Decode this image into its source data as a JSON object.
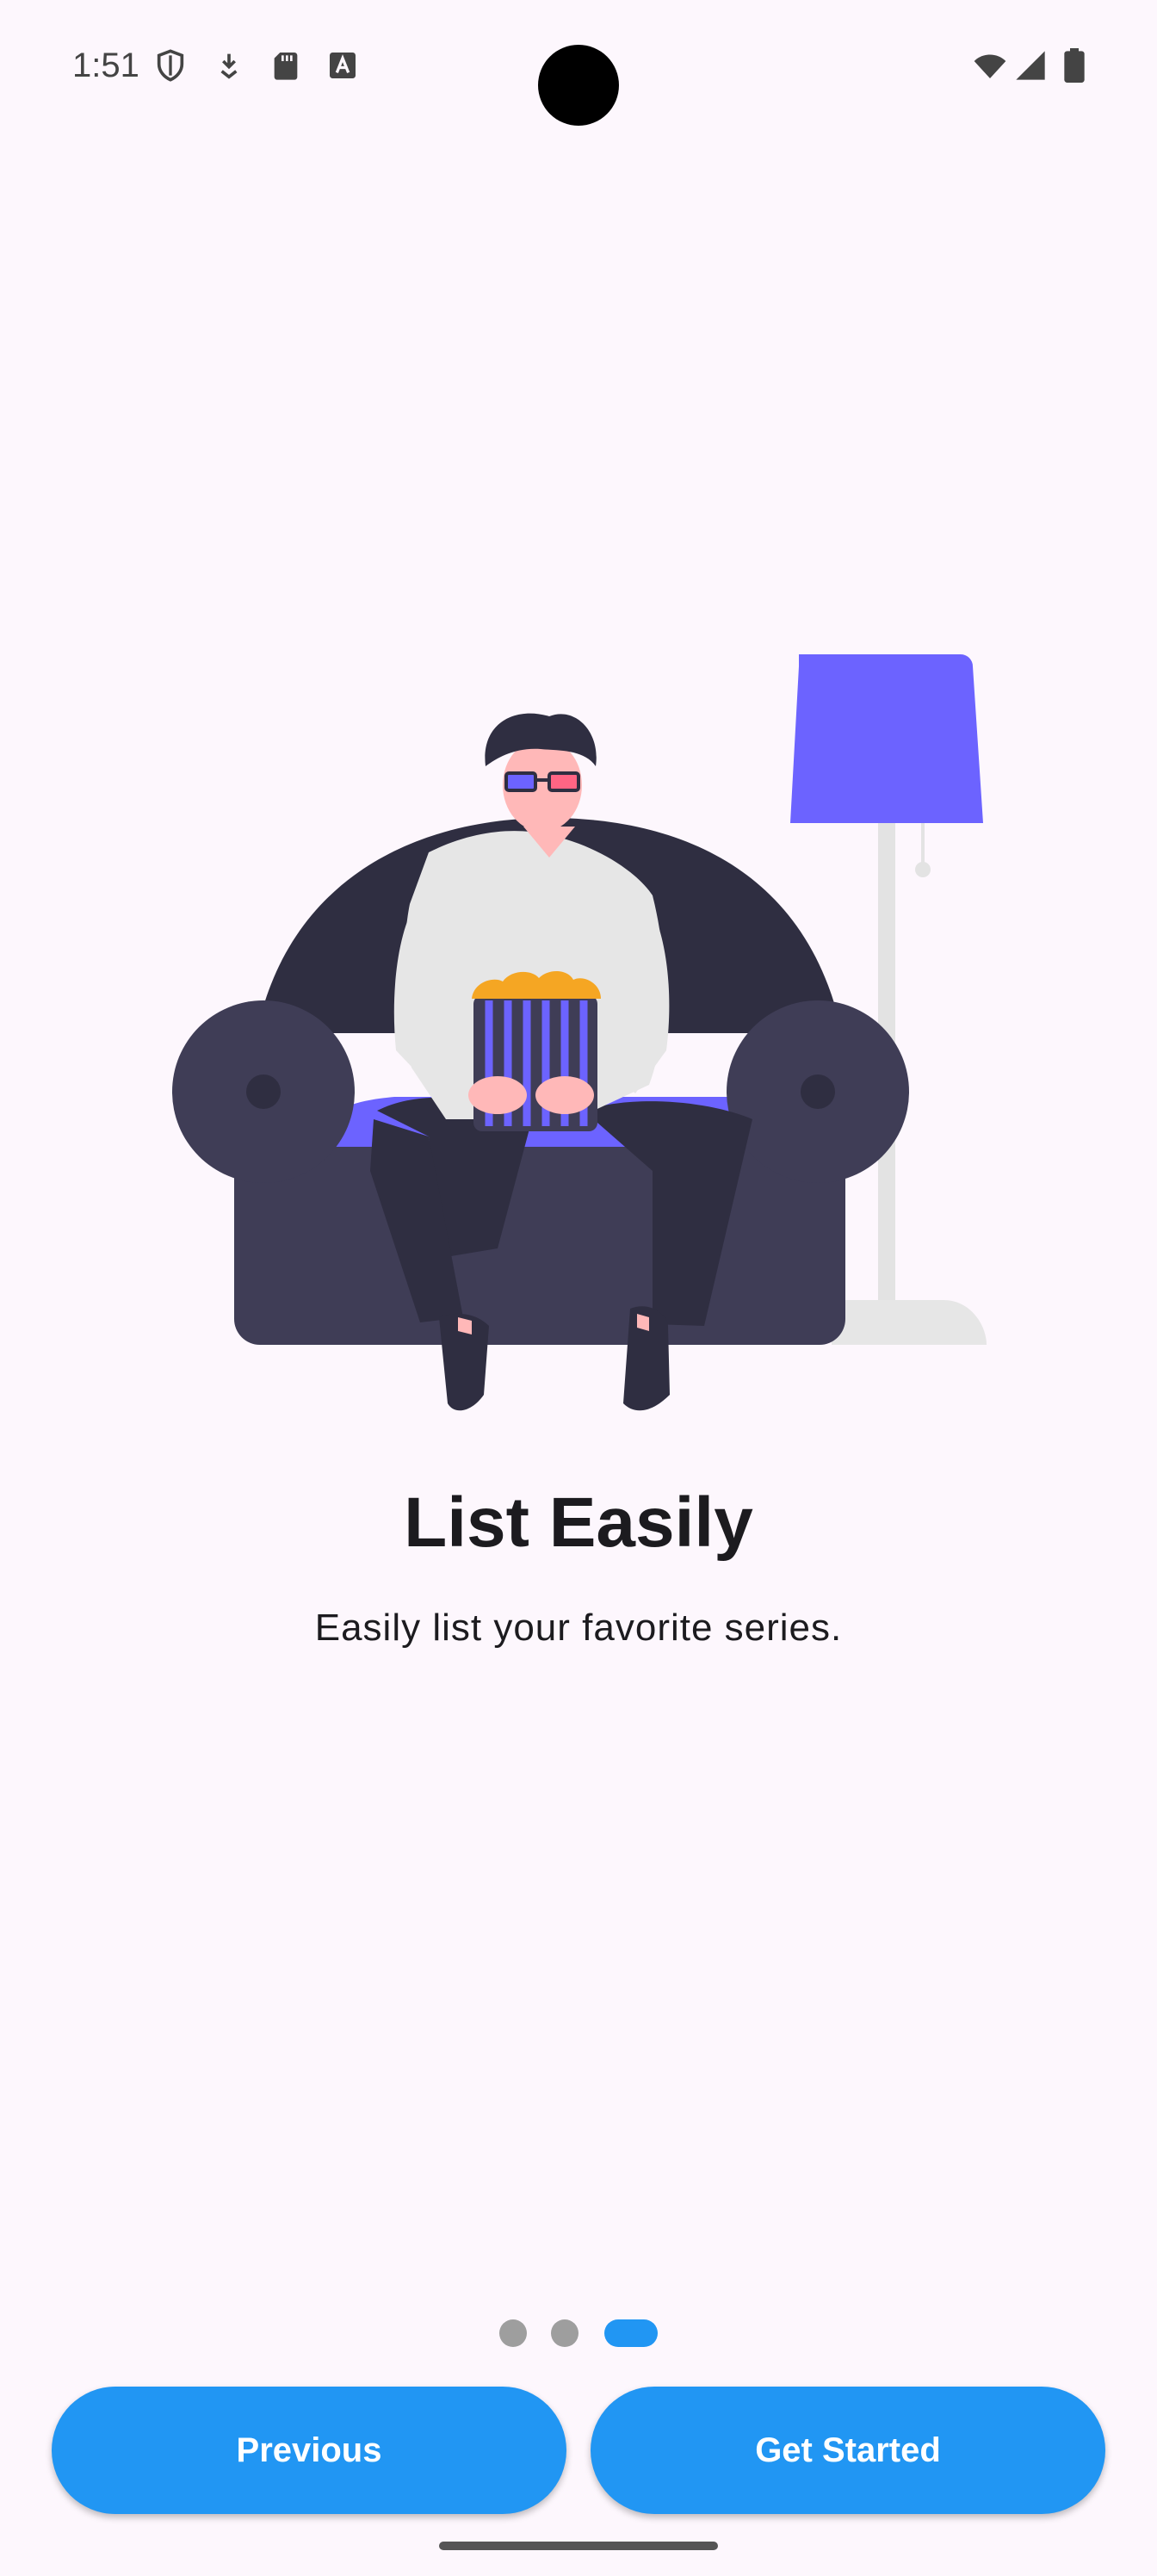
{
  "status_bar": {
    "time": "1:51",
    "left_icons": [
      "shield-icon",
      "download-icon",
      "sd-card-icon",
      "text-a-icon"
    ],
    "right_icons": [
      "wifi-icon",
      "signal-icon",
      "battery-icon"
    ]
  },
  "onboarding": {
    "title": "List Easily",
    "subtitle": "Easily list your favorite series.",
    "page_count": 3,
    "current_page": 3
  },
  "buttons": {
    "previous_label": "Previous",
    "next_label": "Get Started"
  },
  "colors": {
    "accent": "#2196f3",
    "illustration_accent": "#6c63ff",
    "sofa": "#3f3d56",
    "background": "#fdf7fd",
    "dot_inactive": "#9e9e9e"
  }
}
